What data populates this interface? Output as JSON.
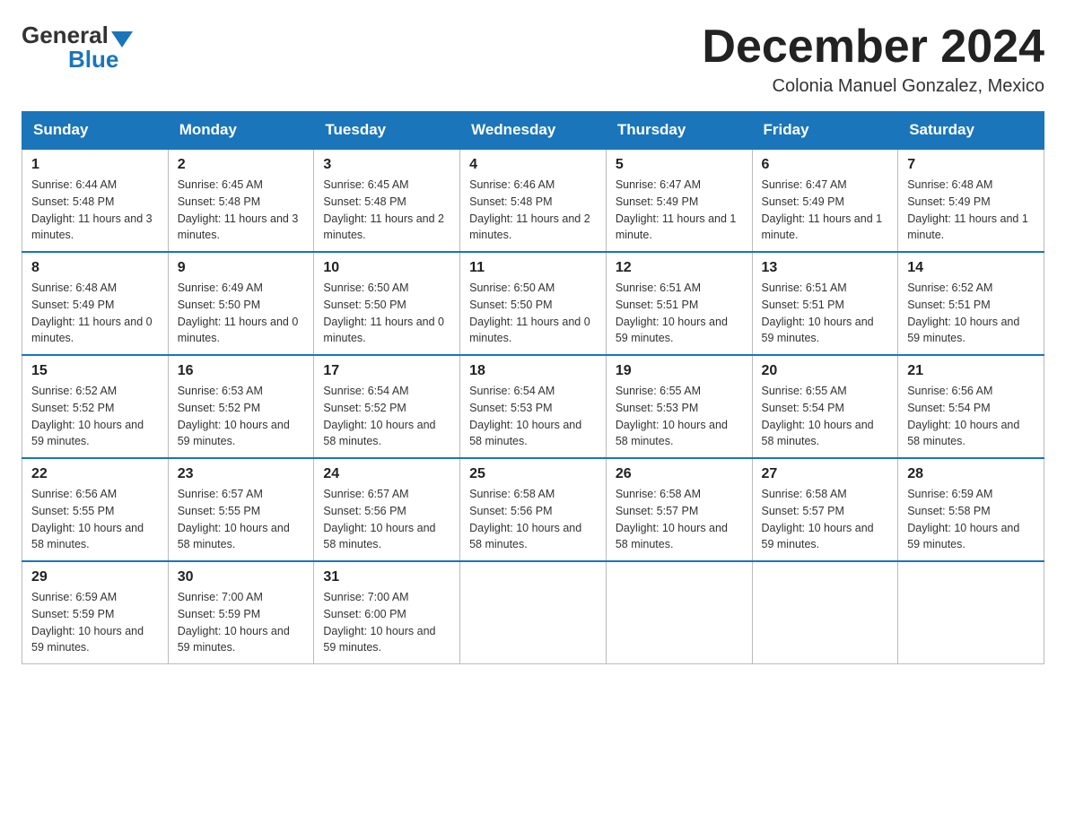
{
  "logo": {
    "general": "General",
    "blue": "Blue"
  },
  "title": "December 2024",
  "subtitle": "Colonia Manuel Gonzalez, Mexico",
  "weekdays": [
    "Sunday",
    "Monday",
    "Tuesday",
    "Wednesday",
    "Thursday",
    "Friday",
    "Saturday"
  ],
  "weeks": [
    [
      {
        "day": "1",
        "sunrise": "6:44 AM",
        "sunset": "5:48 PM",
        "daylight": "11 hours and 3 minutes."
      },
      {
        "day": "2",
        "sunrise": "6:45 AM",
        "sunset": "5:48 PM",
        "daylight": "11 hours and 3 minutes."
      },
      {
        "day": "3",
        "sunrise": "6:45 AM",
        "sunset": "5:48 PM",
        "daylight": "11 hours and 2 minutes."
      },
      {
        "day": "4",
        "sunrise": "6:46 AM",
        "sunset": "5:48 PM",
        "daylight": "11 hours and 2 minutes."
      },
      {
        "day": "5",
        "sunrise": "6:47 AM",
        "sunset": "5:49 PM",
        "daylight": "11 hours and 1 minute."
      },
      {
        "day": "6",
        "sunrise": "6:47 AM",
        "sunset": "5:49 PM",
        "daylight": "11 hours and 1 minute."
      },
      {
        "day": "7",
        "sunrise": "6:48 AM",
        "sunset": "5:49 PM",
        "daylight": "11 hours and 1 minute."
      }
    ],
    [
      {
        "day": "8",
        "sunrise": "6:48 AM",
        "sunset": "5:49 PM",
        "daylight": "11 hours and 0 minutes."
      },
      {
        "day": "9",
        "sunrise": "6:49 AM",
        "sunset": "5:50 PM",
        "daylight": "11 hours and 0 minutes."
      },
      {
        "day": "10",
        "sunrise": "6:50 AM",
        "sunset": "5:50 PM",
        "daylight": "11 hours and 0 minutes."
      },
      {
        "day": "11",
        "sunrise": "6:50 AM",
        "sunset": "5:50 PM",
        "daylight": "11 hours and 0 minutes."
      },
      {
        "day": "12",
        "sunrise": "6:51 AM",
        "sunset": "5:51 PM",
        "daylight": "10 hours and 59 minutes."
      },
      {
        "day": "13",
        "sunrise": "6:51 AM",
        "sunset": "5:51 PM",
        "daylight": "10 hours and 59 minutes."
      },
      {
        "day": "14",
        "sunrise": "6:52 AM",
        "sunset": "5:51 PM",
        "daylight": "10 hours and 59 minutes."
      }
    ],
    [
      {
        "day": "15",
        "sunrise": "6:52 AM",
        "sunset": "5:52 PM",
        "daylight": "10 hours and 59 minutes."
      },
      {
        "day": "16",
        "sunrise": "6:53 AM",
        "sunset": "5:52 PM",
        "daylight": "10 hours and 59 minutes."
      },
      {
        "day": "17",
        "sunrise": "6:54 AM",
        "sunset": "5:52 PM",
        "daylight": "10 hours and 58 minutes."
      },
      {
        "day": "18",
        "sunrise": "6:54 AM",
        "sunset": "5:53 PM",
        "daylight": "10 hours and 58 minutes."
      },
      {
        "day": "19",
        "sunrise": "6:55 AM",
        "sunset": "5:53 PM",
        "daylight": "10 hours and 58 minutes."
      },
      {
        "day": "20",
        "sunrise": "6:55 AM",
        "sunset": "5:54 PM",
        "daylight": "10 hours and 58 minutes."
      },
      {
        "day": "21",
        "sunrise": "6:56 AM",
        "sunset": "5:54 PM",
        "daylight": "10 hours and 58 minutes."
      }
    ],
    [
      {
        "day": "22",
        "sunrise": "6:56 AM",
        "sunset": "5:55 PM",
        "daylight": "10 hours and 58 minutes."
      },
      {
        "day": "23",
        "sunrise": "6:57 AM",
        "sunset": "5:55 PM",
        "daylight": "10 hours and 58 minutes."
      },
      {
        "day": "24",
        "sunrise": "6:57 AM",
        "sunset": "5:56 PM",
        "daylight": "10 hours and 58 minutes."
      },
      {
        "day": "25",
        "sunrise": "6:58 AM",
        "sunset": "5:56 PM",
        "daylight": "10 hours and 58 minutes."
      },
      {
        "day": "26",
        "sunrise": "6:58 AM",
        "sunset": "5:57 PM",
        "daylight": "10 hours and 58 minutes."
      },
      {
        "day": "27",
        "sunrise": "6:58 AM",
        "sunset": "5:57 PM",
        "daylight": "10 hours and 59 minutes."
      },
      {
        "day": "28",
        "sunrise": "6:59 AM",
        "sunset": "5:58 PM",
        "daylight": "10 hours and 59 minutes."
      }
    ],
    [
      {
        "day": "29",
        "sunrise": "6:59 AM",
        "sunset": "5:59 PM",
        "daylight": "10 hours and 59 minutes."
      },
      {
        "day": "30",
        "sunrise": "7:00 AM",
        "sunset": "5:59 PM",
        "daylight": "10 hours and 59 minutes."
      },
      {
        "day": "31",
        "sunrise": "7:00 AM",
        "sunset": "6:00 PM",
        "daylight": "10 hours and 59 minutes."
      },
      null,
      null,
      null,
      null
    ]
  ]
}
